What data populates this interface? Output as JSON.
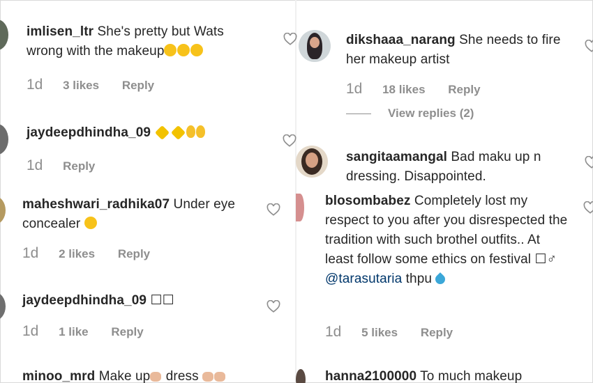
{
  "left": [
    {
      "user": "imlisen_ltr",
      "text": "She's pretty but Wats wrong with the makeup",
      "time": "1d",
      "likes": "3 likes",
      "reply": "Reply"
    },
    {
      "user": "jaydeepdhindha_09",
      "text": "",
      "time": "1d",
      "likes": "",
      "reply": "Reply"
    },
    {
      "user": "maheshwari_radhika07",
      "text": "Under eye concealer",
      "time": "1d",
      "likes": "2 likes",
      "reply": "Reply"
    },
    {
      "user": "jaydeepdhindha_09",
      "text": "☐☐",
      "time": "1d",
      "likes": "1 like",
      "reply": "Reply"
    },
    {
      "user": "minoo_mrd",
      "text": "Make up",
      "text2": "dress"
    }
  ],
  "right": [
    {
      "user": "dikshaaa_narang",
      "text": "She needs to fire her makeup artist",
      "time": "1d",
      "likes": "18 likes",
      "reply": "Reply",
      "view_replies": "View replies (2)"
    },
    {
      "user": "sangitaamangal",
      "text": "Bad maku up n dressing. Disappointed."
    },
    {
      "user": "blosombabez",
      "text": "Completely lost my respect to you after you disrespected the tradition with such brothel outfits.. At least follow some ethics on festival ☐♂",
      "mention": "@tarasutaria",
      "text_after": "thpu",
      "time": "1d",
      "likes": "5 likes",
      "reply": "Reply"
    },
    {
      "user": "hanna2100000",
      "text": "To much makeup"
    }
  ],
  "colors": {
    "text": "#262626",
    "meta": "#8e8e8e",
    "mention": "#00376b",
    "heart": "#8e8e8e"
  }
}
